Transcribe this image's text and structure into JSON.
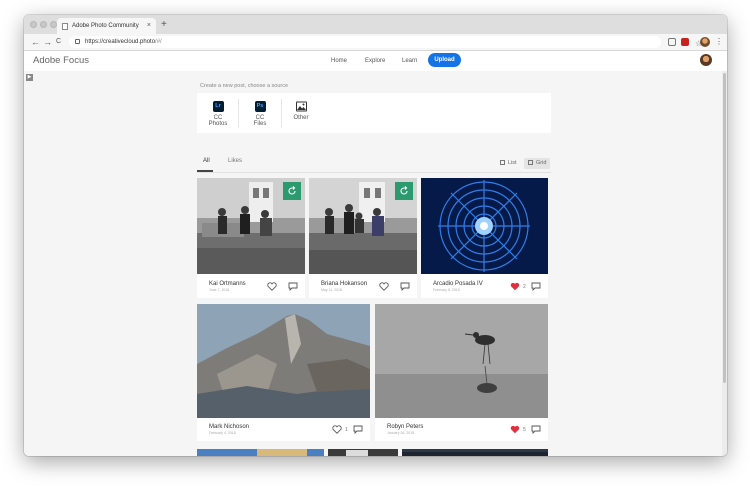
{
  "browser": {
    "tab_title": "Adobe Photo Community",
    "tab_close": "×",
    "new_tab": "+",
    "url_host": "https://creativecloud.photo",
    "url_path": "/#/",
    "back": "←",
    "forward": "→",
    "reload": "C",
    "star": "☆",
    "menu": "⋮"
  },
  "header": {
    "brand": "Adobe Focus",
    "nav": [
      "Home",
      "Explore",
      "Learn"
    ],
    "upload": "Upload"
  },
  "source_picker": {
    "title": "Create a new post, choose a source",
    "sources": [
      {
        "label": "CC Photos",
        "icon": "Lr",
        "icon_bg": "#001d34",
        "icon_fg": "#31a8ff"
      },
      {
        "label": "CC Files",
        "icon": "Ps",
        "icon_bg": "#001d34",
        "icon_fg": "#31a8ff"
      },
      {
        "label": "Other",
        "icon": "image-icon"
      }
    ]
  },
  "filters": {
    "tabs": [
      "All",
      "Likes"
    ],
    "active": "All",
    "views": [
      "List",
      "Grid"
    ],
    "selected_view": "Grid"
  },
  "posts": [
    {
      "author": "Kai Ortmanns",
      "date": "June 7, 2018",
      "liked": false,
      "likes": "",
      "synced": true
    },
    {
      "author": "Briana Hokanson",
      "date": "May 11, 2018",
      "liked": false,
      "likes": "",
      "synced": true
    },
    {
      "author": "Arcadio Posada IV",
      "date": "February 8, 2018",
      "liked": true,
      "likes": "2",
      "synced": false
    },
    {
      "author": "Mark Nichoson",
      "date": "February 4, 2018",
      "liked": false,
      "likes": "1",
      "synced": false
    },
    {
      "author": "Robyn Peters",
      "date": "January 26, 2018",
      "liked": true,
      "likes": "5",
      "synced": false
    }
  ],
  "colors": {
    "accent": "#1473e6",
    "liked": "#e0303d",
    "sync_badge": "#2b9a6e"
  }
}
